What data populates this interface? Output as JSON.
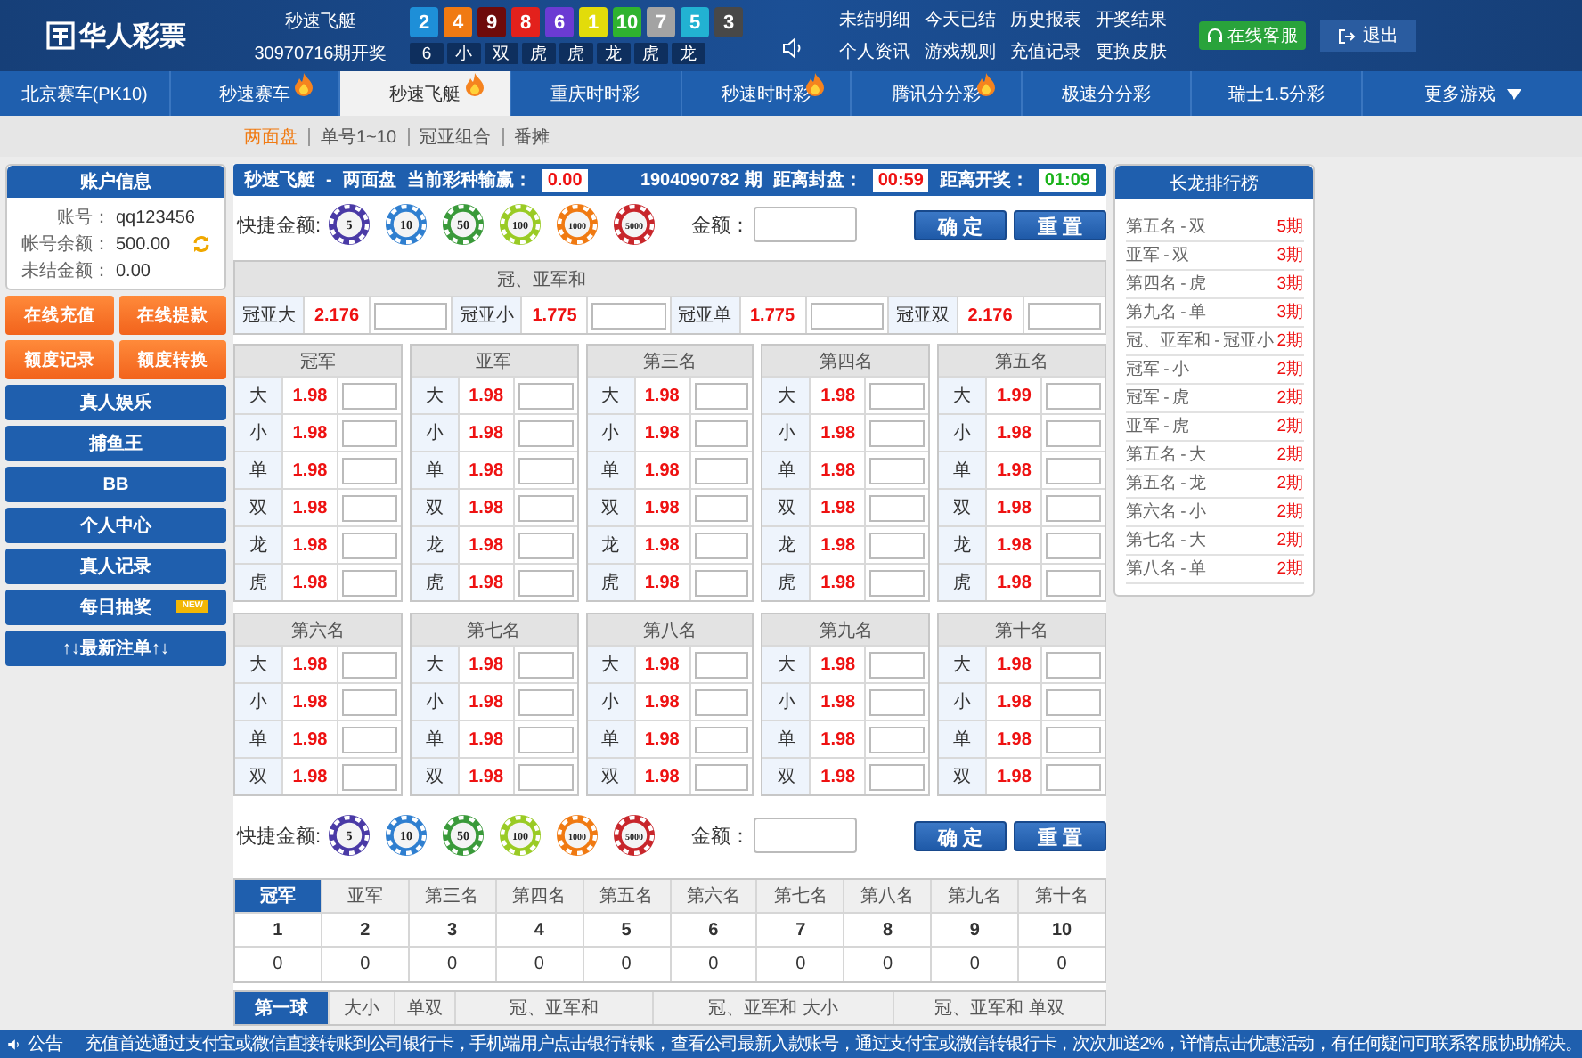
{
  "header": {
    "logo": "华人彩票",
    "game": "秒速飞艇",
    "issue": "30970716期开奖",
    "balls": [
      {
        "number": "2",
        "color": "#1e8fd8"
      },
      {
        "number": "4",
        "color": "#f07a12"
      },
      {
        "number": "9",
        "color": "#6e0b0b"
      },
      {
        "number": "8",
        "color": "#e3211c"
      },
      {
        "number": "6",
        "color": "#6b3bd3"
      },
      {
        "number": "1",
        "color": "#e2dc0a"
      },
      {
        "number": "10",
        "color": "#2fb32f"
      },
      {
        "number": "7",
        "color": "#a3a3a3"
      },
      {
        "number": "5",
        "color": "#22b2d2"
      },
      {
        "number": "3",
        "color": "#484848"
      }
    ],
    "ball_labels": [
      "6",
      "小",
      "双",
      "虎",
      "虎",
      "龙",
      "虎",
      "龙"
    ],
    "links": [
      "未结明细",
      "今天已结",
      "历史报表",
      "开奖结果",
      "个人资讯",
      "游戏规则",
      "充值记录",
      "更换皮肤"
    ],
    "service_button": "在线客服",
    "logout_button": "退出"
  },
  "nav": {
    "tabs": [
      {
        "label": "北京赛车(PK10)",
        "selected": false,
        "hot": false
      },
      {
        "label": "秒速赛车",
        "selected": false,
        "hot": true
      },
      {
        "label": "秒速飞艇",
        "selected": true,
        "hot": true
      },
      {
        "label": "重庆时时彩",
        "selected": false,
        "hot": false
      },
      {
        "label": "秒速时时彩",
        "selected": false,
        "hot": true
      },
      {
        "label": "腾讯分分彩",
        "selected": false,
        "hot": true
      },
      {
        "label": "极速分分彩",
        "selected": false,
        "hot": false
      },
      {
        "label": "瑞士1.5分彩",
        "selected": false,
        "hot": false
      }
    ],
    "more": "更多游戏"
  },
  "subnav": [
    {
      "label": "两面盘",
      "selected": true
    },
    {
      "label": "单号1~10",
      "selected": false
    },
    {
      "label": "冠亚组合",
      "selected": false
    },
    {
      "label": "番摊",
      "selected": false
    }
  ],
  "account": {
    "title": "账户信息",
    "fields": [
      {
        "label": "账号：",
        "value": "qq123456",
        "refreshable": false
      },
      {
        "label": "帐号余额：",
        "value": "500.00",
        "refreshable": true
      },
      {
        "label": "未结金额：",
        "value": "0.00",
        "refreshable": false
      }
    ]
  },
  "sidebar": {
    "action_buttons": [
      "在线充值",
      "在线提款",
      "额度记录",
      "额度转换"
    ],
    "menu": [
      {
        "label": "真人娱乐"
      },
      {
        "label": "捕鱼王"
      },
      {
        "label": "BB"
      },
      {
        "label": "个人中心"
      },
      {
        "label": "真人记录"
      },
      {
        "label": "每日抽奖",
        "badge": "NEW"
      },
      {
        "label": "↑↓最新注单↑↓"
      }
    ]
  },
  "bet_header": {
    "game": "秒速飞艇",
    "separator": "-",
    "mode": "两面盘",
    "profit_label": "当前彩种输赢：",
    "profit": "0.00",
    "period": "1904090782 期",
    "close_label": "距离封盘：",
    "close_time": "00:59",
    "draw_label": "距离开奖：",
    "draw_time": "01:09"
  },
  "quick_bars": [
    {
      "label": "快捷金额:",
      "chips": [
        {
          "value": "5",
          "color": "#4a3aa6"
        },
        {
          "value": "10",
          "color": "#2f7fd0"
        },
        {
          "value": "50",
          "color": "#3a9a3a"
        },
        {
          "value": "100",
          "color": "#9acb25"
        },
        {
          "value": "1000",
          "color": "#f07a12"
        },
        {
          "value": "5000",
          "color": "#c8262b"
        }
      ],
      "amount_label": "金额：",
      "confirm": "确 定",
      "reset": "重 置"
    },
    {
      "label": "快捷金额:",
      "chips": [
        {
          "value": "5",
          "color": "#4a3aa6"
        },
        {
          "value": "10",
          "color": "#2f7fd0"
        },
        {
          "value": "50",
          "color": "#3a9a3a"
        },
        {
          "value": "100",
          "color": "#9acb25"
        },
        {
          "value": "1000",
          "color": "#f07a12"
        },
        {
          "value": "5000",
          "color": "#c8262b"
        }
      ],
      "amount_label": "金额：",
      "confirm": "确 定",
      "reset": "重 置"
    }
  ],
  "sum_section": {
    "title": "冠、亚军和",
    "items": [
      {
        "label": "冠亚大",
        "odds": "2.176"
      },
      {
        "label": "冠亚小",
        "odds": "1.775"
      },
      {
        "label": "冠亚单",
        "odds": "1.775"
      },
      {
        "label": "冠亚双",
        "odds": "2.176"
      }
    ]
  },
  "positions": [
    {
      "title": "冠军",
      "rows": [
        {
          "label": "大",
          "odds": "1.98"
        },
        {
          "label": "小",
          "odds": "1.98"
        },
        {
          "label": "单",
          "odds": "1.98"
        },
        {
          "label": "双",
          "odds": "1.98"
        },
        {
          "label": "龙",
          "odds": "1.98"
        },
        {
          "label": "虎",
          "odds": "1.98"
        }
      ]
    },
    {
      "title": "亚军",
      "rows": [
        {
          "label": "大",
          "odds": "1.98"
        },
        {
          "label": "小",
          "odds": "1.98"
        },
        {
          "label": "单",
          "odds": "1.98"
        },
        {
          "label": "双",
          "odds": "1.98"
        },
        {
          "label": "龙",
          "odds": "1.98"
        },
        {
          "label": "虎",
          "odds": "1.98"
        }
      ]
    },
    {
      "title": "第三名",
      "rows": [
        {
          "label": "大",
          "odds": "1.98"
        },
        {
          "label": "小",
          "odds": "1.98"
        },
        {
          "label": "单",
          "odds": "1.98"
        },
        {
          "label": "双",
          "odds": "1.98"
        },
        {
          "label": "龙",
          "odds": "1.98"
        },
        {
          "label": "虎",
          "odds": "1.98"
        }
      ]
    },
    {
      "title": "第四名",
      "rows": [
        {
          "label": "大",
          "odds": "1.98"
        },
        {
          "label": "小",
          "odds": "1.98"
        },
        {
          "label": "单",
          "odds": "1.98"
        },
        {
          "label": "双",
          "odds": "1.98"
        },
        {
          "label": "龙",
          "odds": "1.98"
        },
        {
          "label": "虎",
          "odds": "1.98"
        }
      ]
    },
    {
      "title": "第五名",
      "rows": [
        {
          "label": "大",
          "odds": "1.99"
        },
        {
          "label": "小",
          "odds": "1.98"
        },
        {
          "label": "单",
          "odds": "1.98"
        },
        {
          "label": "双",
          "odds": "1.98"
        },
        {
          "label": "龙",
          "odds": "1.98"
        },
        {
          "label": "虎",
          "odds": "1.98"
        }
      ]
    },
    {
      "title": "第六名",
      "rows": [
        {
          "label": "大",
          "odds": "1.98"
        },
        {
          "label": "小",
          "odds": "1.98"
        },
        {
          "label": "单",
          "odds": "1.98"
        },
        {
          "label": "双",
          "odds": "1.98"
        }
      ]
    },
    {
      "title": "第七名",
      "rows": [
        {
          "label": "大",
          "odds": "1.98"
        },
        {
          "label": "小",
          "odds": "1.98"
        },
        {
          "label": "单",
          "odds": "1.98"
        },
        {
          "label": "双",
          "odds": "1.98"
        }
      ]
    },
    {
      "title": "第八名",
      "rows": [
        {
          "label": "大",
          "odds": "1.98"
        },
        {
          "label": "小",
          "odds": "1.98"
        },
        {
          "label": "单",
          "odds": "1.98"
        },
        {
          "label": "双",
          "odds": "1.98"
        }
      ]
    },
    {
      "title": "第九名",
      "rows": [
        {
          "label": "大",
          "odds": "1.98"
        },
        {
          "label": "小",
          "odds": "1.98"
        },
        {
          "label": "单",
          "odds": "1.98"
        },
        {
          "label": "双",
          "odds": "1.98"
        }
      ]
    },
    {
      "title": "第十名",
      "rows": [
        {
          "label": "大",
          "odds": "1.98"
        },
        {
          "label": "小",
          "odds": "1.98"
        },
        {
          "label": "单",
          "odds": "1.98"
        },
        {
          "label": "双",
          "odds": "1.98"
        }
      ]
    }
  ],
  "results": {
    "tabs": [
      {
        "label": "冠军",
        "selected": true
      },
      {
        "label": "亚军",
        "selected": false
      },
      {
        "label": "第三名",
        "selected": false
      },
      {
        "label": "第四名",
        "selected": false
      },
      {
        "label": "第五名",
        "selected": false
      },
      {
        "label": "第六名",
        "selected": false
      },
      {
        "label": "第七名",
        "selected": false
      },
      {
        "label": "第八名",
        "selected": false
      },
      {
        "label": "第九名",
        "selected": false
      },
      {
        "label": "第十名",
        "selected": false
      }
    ],
    "numbers": [
      "1",
      "2",
      "3",
      "4",
      "5",
      "6",
      "7",
      "8",
      "9",
      "10"
    ],
    "counts": [
      "0",
      "0",
      "0",
      "0",
      "0",
      "0",
      "0",
      "0",
      "0",
      "0"
    ]
  },
  "stat_tabs": [
    {
      "label": "第一球",
      "selected": true
    },
    {
      "label": "大小",
      "selected": false
    },
    {
      "label": "单双",
      "selected": false
    },
    {
      "label": "冠、亚军和",
      "selected": false
    },
    {
      "label": "冠、亚军和 大小",
      "selected": false
    },
    {
      "label": "冠、亚军和 单双",
      "selected": false
    }
  ],
  "ranking": {
    "title": "长龙排行榜",
    "items": [
      {
        "name": "第五名 - 双",
        "streak": "5期"
      },
      {
        "name": "亚军 - 双",
        "streak": "3期"
      },
      {
        "name": "第四名 - 虎",
        "streak": "3期"
      },
      {
        "name": "第九名 - 单",
        "streak": "3期"
      },
      {
        "name": "冠、亚军和 - 冠亚小",
        "streak": "2期"
      },
      {
        "name": "冠军 - 小",
        "streak": "2期"
      },
      {
        "name": "冠军 - 虎",
        "streak": "2期"
      },
      {
        "name": "亚军 - 虎",
        "streak": "2期"
      },
      {
        "name": "第五名 - 大",
        "streak": "2期"
      },
      {
        "name": "第五名 - 龙",
        "streak": "2期"
      },
      {
        "name": "第六名 - 小",
        "streak": "2期"
      },
      {
        "name": "第七名 - 大",
        "streak": "2期"
      },
      {
        "name": "第八名 - 单",
        "streak": "2期"
      }
    ]
  },
  "notice": {
    "label": "公告",
    "text": "充值首选通过支付宝或微信直接转账到公司银行卡，手机端用户点击银行转账，查看公司最新入款账号，通过支付宝或微信转银行卡，次次加送2%，详情点击优惠活动，有任何疑问可联系客服协助解决。"
  }
}
